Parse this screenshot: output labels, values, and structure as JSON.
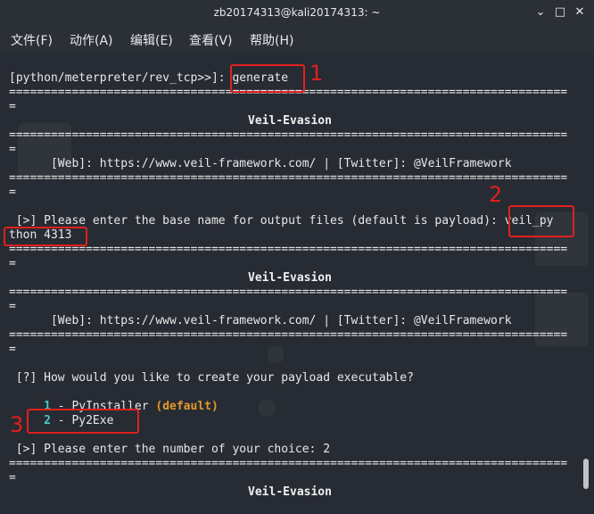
{
  "window": {
    "title": "zb20174313@kali20174313: ~"
  },
  "window_controls": {
    "minimize": "⌄",
    "maximize": "□",
    "close": "✕"
  },
  "menubar": [
    {
      "label": "文件(F)"
    },
    {
      "label": "动作(A)"
    },
    {
      "label": "编辑(E)"
    },
    {
      "label": "查看(V)"
    },
    {
      "label": "帮助(H)"
    }
  ],
  "terminal": {
    "prompt": "[python/meterpreter/rev_tcp>>]: ",
    "command": "generate",
    "separator": "================================================================================",
    "separator_tail": "=",
    "banner_title": "Veil-Evasion",
    "web_line": "      [Web]: https://www.veil-framework.com/ | [Twitter]: @VeilFramework",
    "basename_prompt": " [>] Please enter the base name for output files (default is payload): ",
    "basename_input_part1": "veil_py",
    "basename_input_part2": "thon 4313",
    "question": " [?] How would you like to create your payload executable?",
    "option1_num": "1",
    "option1_label": " - PyInstaller ",
    "option1_default": "(default)",
    "option2_num": "2",
    "option2_label": " - Py2Exe",
    "choice_prompt": " [>] Please enter the number of your choice: 2"
  },
  "annotations": {
    "label1": "1",
    "label2": "2",
    "label3": "3"
  },
  "colors": {
    "annotation": "#e0201e",
    "option_number": "#4fc9c9",
    "default_tag": "#e39a2d"
  }
}
